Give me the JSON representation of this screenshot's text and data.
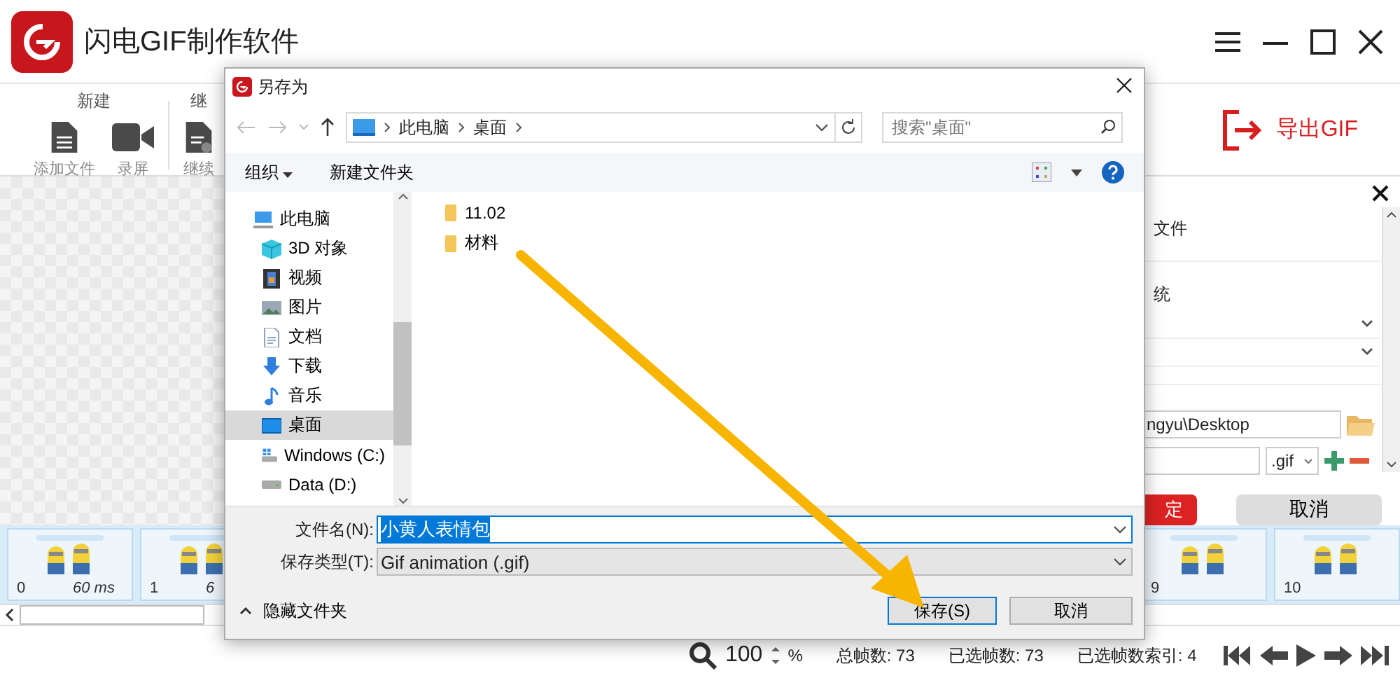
{
  "app": {
    "title": "闪电GIF制作软件"
  },
  "toolbar": {
    "groups": [
      {
        "label": "新建",
        "items": [
          {
            "label": "添加文件",
            "kind": "file"
          },
          {
            "label": "录屏",
            "kind": "camera"
          }
        ]
      },
      {
        "label": "继",
        "items": [
          {
            "label": "继续",
            "kind": "file-add"
          }
        ]
      }
    ],
    "export_label": "导出GIF"
  },
  "side_panel": {
    "section_1": "文件",
    "section_2": "统",
    "path": "ngyu\\Desktop",
    "extension": ".gif",
    "confirm": "定",
    "cancel": "取消"
  },
  "frames": {
    "start": [
      {
        "index": "0",
        "duration": "60 ms"
      },
      {
        "index": "1",
        "duration": "6"
      }
    ],
    "end": [
      {
        "index": "9"
      },
      {
        "index": "10"
      }
    ]
  },
  "status": {
    "zoom": "100",
    "unit": "%",
    "stats": [
      "总帧数: 73",
      "已选帧数: 73",
      "已选帧数索引: 4"
    ]
  },
  "dialog": {
    "title": "另存为",
    "path": [
      "此电脑",
      "桌面"
    ],
    "search_placeholder": "搜索\"桌面\"",
    "organize": "组织",
    "new_folder": "新建文件夹",
    "nav": [
      {
        "label": "此电脑",
        "kind": "pc",
        "selected": false
      },
      {
        "label": "3D 对象",
        "kind": "cube",
        "selected": false
      },
      {
        "label": "视频",
        "kind": "video",
        "selected": false
      },
      {
        "label": "图片",
        "selected": false
      },
      {
        "label": "文档",
        "kind": "doc",
        "selected": false
      },
      {
        "label": "下载",
        "kind": "download",
        "selected": false
      },
      {
        "label": "音乐",
        "kind": "music",
        "selected": false
      },
      {
        "label": "桌面",
        "kind": "desktop",
        "selected": true
      },
      {
        "label": "Windows (C:)",
        "kind": "system-drive",
        "selected": false
      },
      {
        "label": "Data (D:)",
        "kind": "drive",
        "selected": false
      }
    ],
    "files": [
      {
        "name": "11.02"
      },
      {
        "name": "材料"
      }
    ],
    "filename_label": "文件名(N):",
    "filename": "小黄人表情包",
    "filename_selected": true,
    "type_label": "保存类型(T):",
    "type": "Gif animation (.gif)",
    "hide_folders": "隐藏文件夹",
    "save": "保存(S)",
    "cancel": "取消"
  }
}
